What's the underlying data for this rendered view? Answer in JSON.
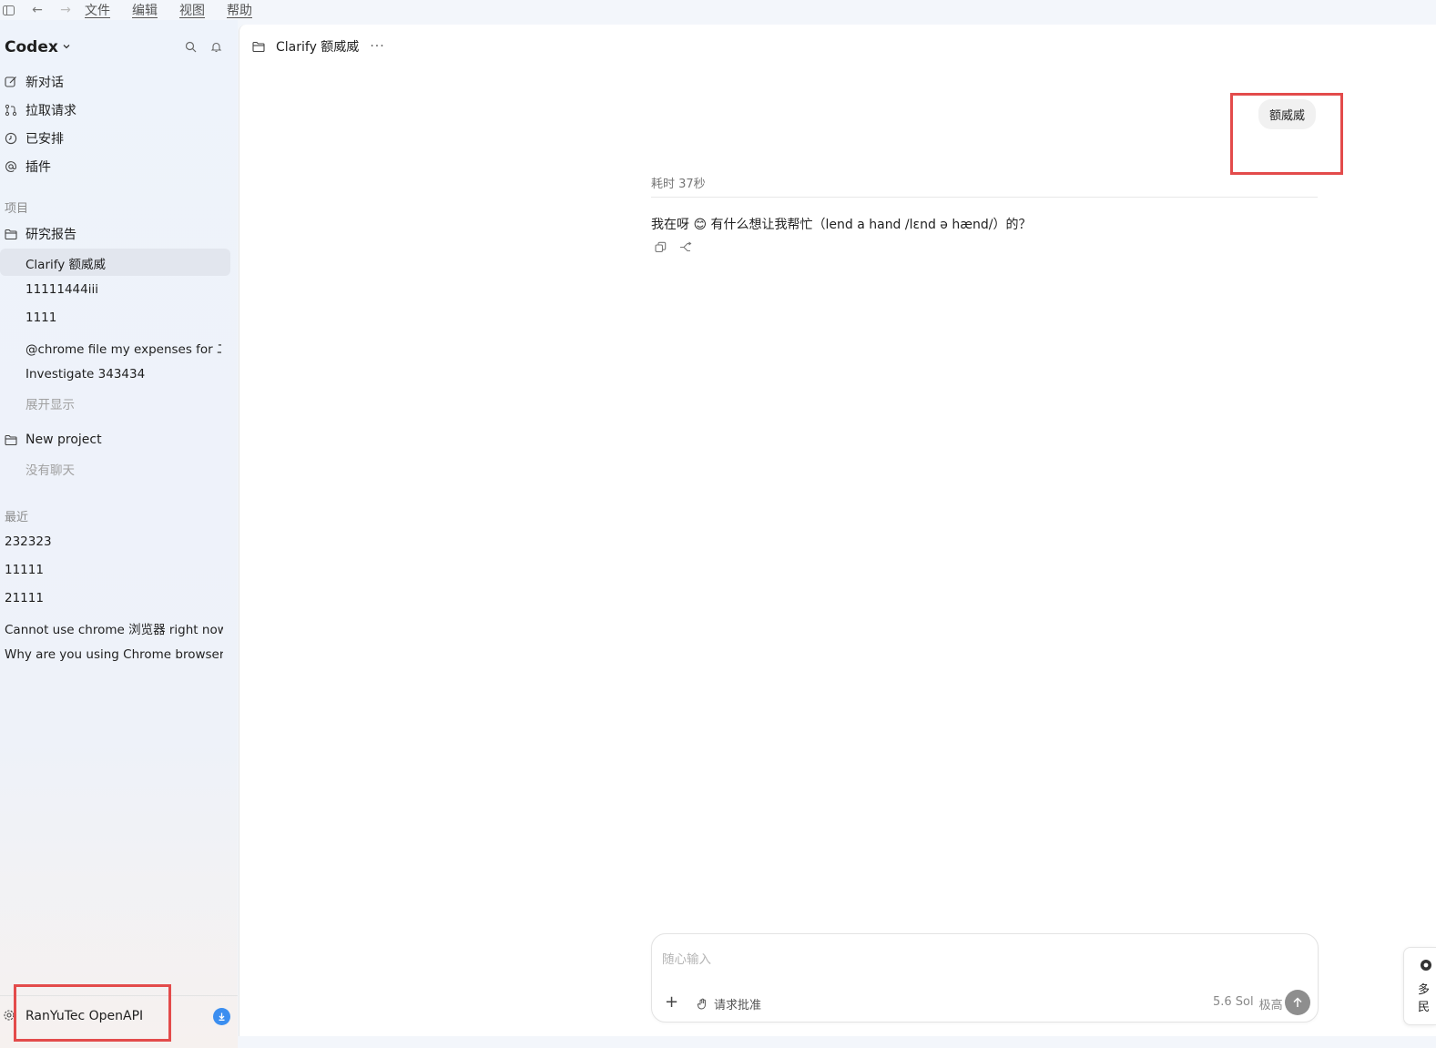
{
  "menubar": {
    "items": [
      "文件",
      "编辑",
      "视图",
      "帮助"
    ]
  },
  "sidebar": {
    "brand": "Codex",
    "nav": [
      {
        "icon": "edit-icon",
        "label": "新对话"
      },
      {
        "icon": "pull-request-icon",
        "label": "拉取请求"
      },
      {
        "icon": "clock-icon",
        "label": "已安排"
      },
      {
        "icon": "at-icon",
        "label": "插件"
      }
    ],
    "projects_label": "项目",
    "projects": [
      {
        "name": "研究报告",
        "threads": [
          "Clarify 额威威",
          "11111444iii",
          "1111",
          "@chrome file my expenses for 二二",
          "Investigate 343434"
        ],
        "show_more": "展开显示"
      },
      {
        "name": "New project",
        "empty": "没有聊天"
      }
    ],
    "recent_label": "最近",
    "recent": [
      "232323",
      "11111",
      "21111",
      "Cannot use chrome 浏览器 right now",
      "Why are you using Chrome browser no"
    ],
    "account": "RanYuTec OpenAPI"
  },
  "main": {
    "title": "Clarify 额威威",
    "more": "···",
    "user_message": "额威威",
    "elapsed": "耗时 37秒",
    "answer": "我在呀 😊 有什么想让我帮忙（lend a hand /lɛnd ə hænd/）的？",
    "composer": {
      "placeholder": "随心输入",
      "approval": "请求批准",
      "model": "5.6 Sol",
      "effort": "极高"
    }
  },
  "popup": {
    "line1": "多",
    "line2": "民"
  },
  "colors": {
    "highlight_box": "#e34b4b",
    "accent": "#3b8ef0"
  }
}
